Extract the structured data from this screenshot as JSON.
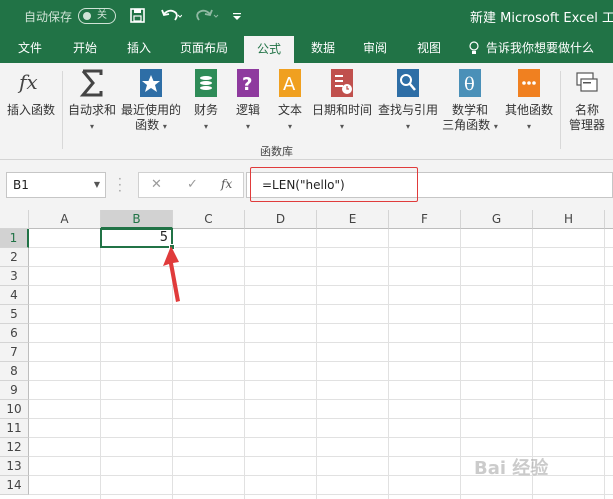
{
  "titlebar": {
    "autosave_label": "自动保存",
    "autosave_state": "关",
    "doc_title": "新建 Microsoft Excel 工作"
  },
  "tabs": [
    {
      "label": "文件",
      "active": false
    },
    {
      "label": "开始",
      "active": false
    },
    {
      "label": "插入",
      "active": false
    },
    {
      "label": "页面布局",
      "active": false
    },
    {
      "label": "公式",
      "active": true
    },
    {
      "label": "数据",
      "active": false
    },
    {
      "label": "审阅",
      "active": false
    },
    {
      "label": "视图",
      "active": false
    }
  ],
  "tell_me": "告诉我你想要做什么",
  "ribbon": {
    "insert_function": "插入函数",
    "autosum": {
      "line1": "自动求和",
      "caret": "▾"
    },
    "recent": {
      "line1": "最近使用的",
      "line2": "函数"
    },
    "financial": "财务",
    "logical": "逻辑",
    "text": "文本",
    "datetime": "日期和时间",
    "lookup": "查找与引用",
    "math": {
      "line1": "数学和",
      "line2": "三角函数"
    },
    "more": "其他函数",
    "name_manager": {
      "line1": "名称",
      "line2": "管理器"
    },
    "group_label": "函数库",
    "text_icon_glyph": "A",
    "math_icon_glyph": "θ"
  },
  "formula_bar": {
    "name_box": "B1",
    "cancel": "✕",
    "enter": "✓",
    "fx": "fx",
    "formula": "=LEN(\"hello\")"
  },
  "grid": {
    "columns": [
      "A",
      "B",
      "C",
      "D",
      "E",
      "F",
      "G",
      "H"
    ],
    "rows": [
      "1",
      "2",
      "3",
      "4",
      "5",
      "6",
      "7",
      "8",
      "9",
      "10",
      "11",
      "12",
      "13",
      "14"
    ],
    "active_cell_value": "5",
    "selected_column": "B",
    "selected_row": "1"
  },
  "watermark": "Bai 经验",
  "colors": {
    "excel_green": "#217346",
    "annotation_red": "#e03b3b"
  }
}
